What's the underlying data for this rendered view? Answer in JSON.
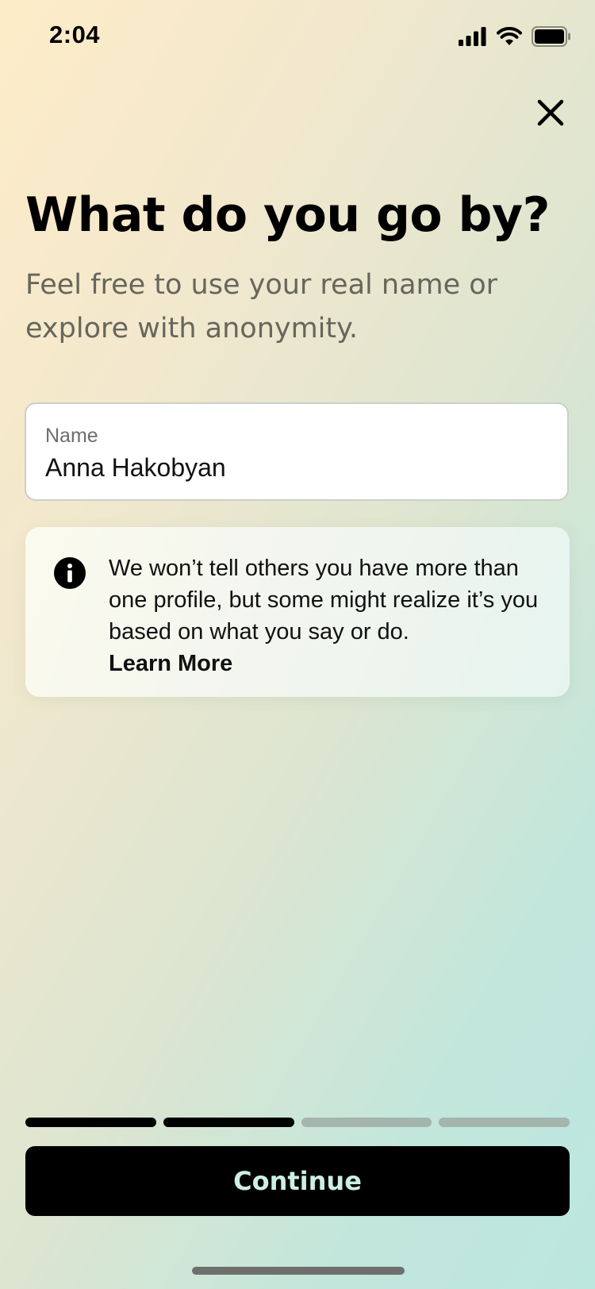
{
  "status_bar": {
    "time": "2:04",
    "icons": [
      "cellular-signal-icon",
      "wifi-icon",
      "battery-icon"
    ]
  },
  "close_icon": "close-icon",
  "title": "What do you go by?",
  "subtitle": "Feel free to use your real name or explore with anonymity.",
  "name_field": {
    "label": "Name",
    "value": "Anna Hakobyan"
  },
  "info": {
    "icon": "info-icon",
    "message": "We won’t tell others you have more than one profile, but some might realize it’s you based on what you say or do.",
    "link": "Learn More"
  },
  "progress": {
    "current_step": 2,
    "total_steps": 4
  },
  "continue_button": "Continue",
  "colors": {
    "button_bg": "#000000",
    "button_text": "#cdeee4",
    "progress_done": "#000000",
    "progress_pending": "#a4b5ae",
    "subtitle": "#66665c"
  }
}
